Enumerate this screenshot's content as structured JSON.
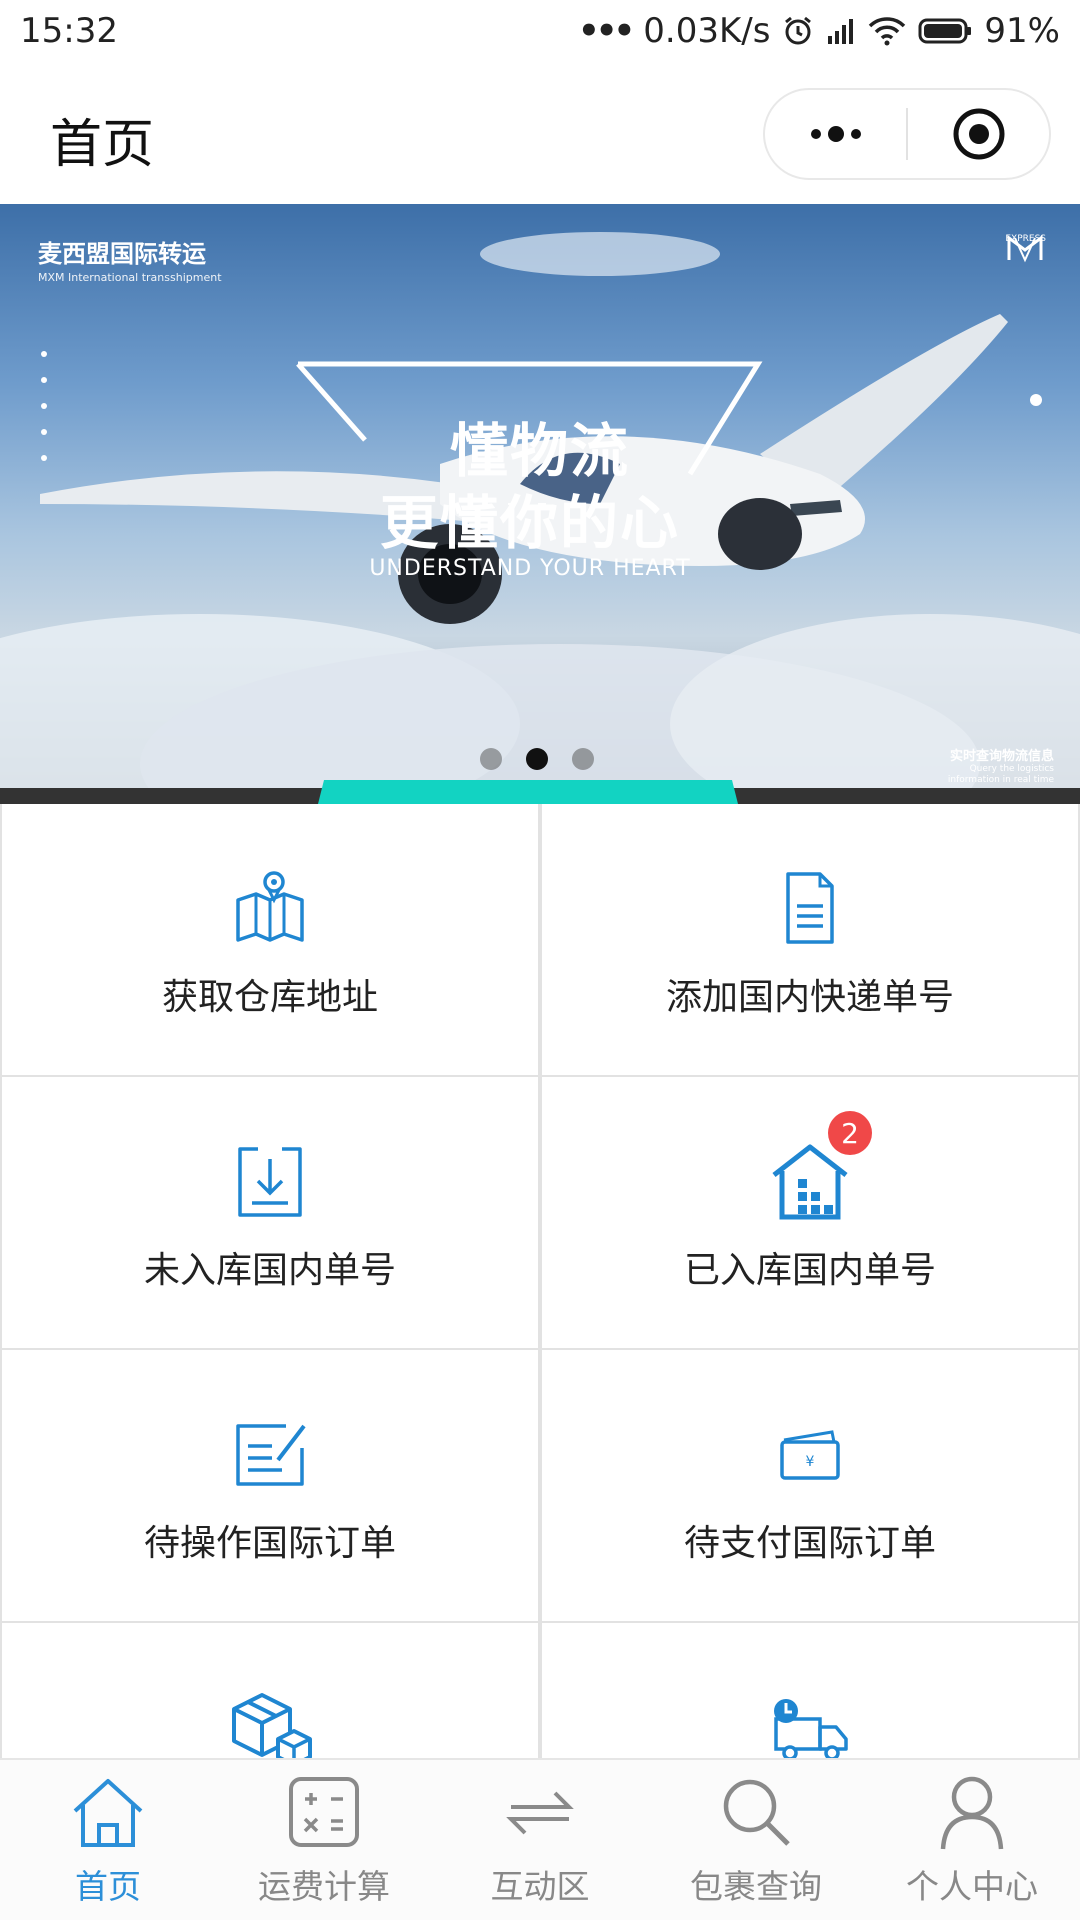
{
  "status_bar": {
    "time": "15:32",
    "signal_dots": "•••",
    "speed": "0.03K/s",
    "battery": "91%"
  },
  "header": {
    "title": "首页"
  },
  "banner": {
    "brand_cn": "麦西盟国际转运",
    "brand_en": "MXM International transshipment",
    "logo_sub": "EXPRESS",
    "slogan_line1": "懂物流",
    "slogan_line2": "更懂你的心",
    "slogan_en": "UNDERSTAND YOUR HEART",
    "corner_cn": "实时查询物流信息",
    "corner_en1": "Query the logistics",
    "corner_en2": "information in real time",
    "active_slide": 2,
    "slide_count": 3
  },
  "grid": {
    "items": [
      {
        "label": "获取仓库地址",
        "icon": "map-pin-icon"
      },
      {
        "label": "添加国内快递单号",
        "icon": "document-icon"
      },
      {
        "label": "未入库国内单号",
        "icon": "download-tray-icon"
      },
      {
        "label": "已入库国内单号",
        "icon": "warehouse-icon",
        "badge": "2"
      },
      {
        "label": "待操作国际订单",
        "icon": "edit-list-icon"
      },
      {
        "label": "待支付国际订单",
        "icon": "payment-card-icon"
      },
      {
        "label": "",
        "icon": "boxes-icon"
      },
      {
        "label": "",
        "icon": "delivery-truck-icon"
      }
    ]
  },
  "tabbar": {
    "items": [
      {
        "label": "首页",
        "icon": "home-icon",
        "active": true
      },
      {
        "label": "运费计算",
        "icon": "calculator-icon"
      },
      {
        "label": "互动区",
        "icon": "exchange-icon"
      },
      {
        "label": "包裹查询",
        "icon": "search-icon"
      },
      {
        "label": "个人中心",
        "icon": "user-icon"
      }
    ]
  },
  "colors": {
    "accent_blue": "#2c8fd8",
    "icon_blue": "#1f86d1",
    "badge_red": "#f04848",
    "banner_accent": "#12d3c2"
  }
}
